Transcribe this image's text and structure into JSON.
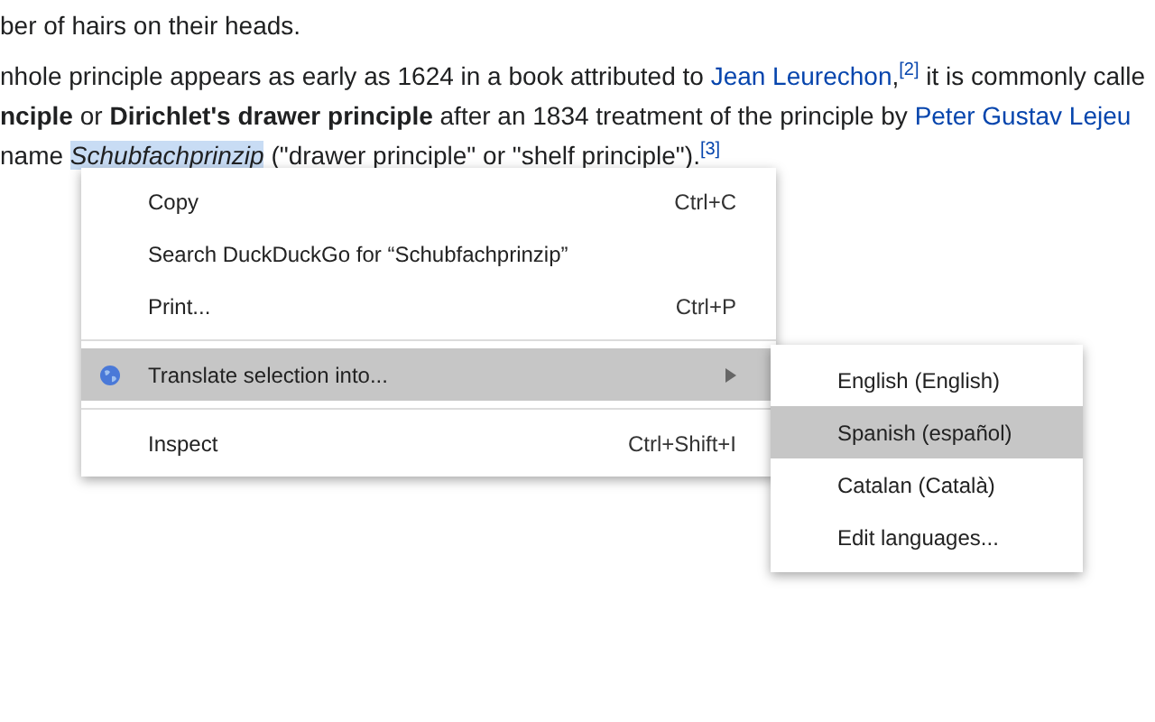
{
  "article": {
    "lines": [
      [
        {
          "kind": "text",
          "text": "ber of hairs on their heads."
        }
      ],
      [
        {
          "kind": "text",
          "text": "nhole principle appears as early as 1624 in a book attributed to "
        },
        {
          "kind": "link",
          "text": "Jean Leurechon"
        },
        {
          "kind": "ref",
          "lead": ",",
          "text": "[2]"
        },
        {
          "kind": "text",
          "text": " it is commonly calle"
        }
      ],
      [
        {
          "kind": "text",
          "text": "**nciple** or **Dirichlet's drawer principle** after an 1834 treatment of the principle by "
        },
        {
          "kind": "link",
          "text": "Peter Gustav Lejeu"
        }
      ],
      [
        {
          "kind": "text",
          "text": "name "
        },
        {
          "kind": "text",
          "text": "Schubfachprinzip",
          "italic": true,
          "selected": true
        },
        {
          "kind": "text",
          "text": " (\"drawer principle\" or \"shelf principle\")."
        },
        {
          "kind": "ref",
          "text": "[3]"
        }
      ]
    ]
  },
  "context_menu": {
    "items": [
      {
        "kind": "item",
        "label": "Copy",
        "shortcut": "Ctrl+C",
        "selected": false
      },
      {
        "kind": "item",
        "label": "Search DuckDuckGo for “Schubfachprinzip”",
        "selected": false
      },
      {
        "kind": "item",
        "label": "Print...",
        "shortcut": "Ctrl+P",
        "selected": false
      },
      {
        "kind": "separator"
      },
      {
        "kind": "submenu",
        "label": "Translate selection into...",
        "selected": true
      },
      {
        "kind": "separator"
      },
      {
        "kind": "item",
        "label": "Inspect",
        "shortcut": "Ctrl+Shift+I",
        "selected": false
      }
    ]
  },
  "submenu": {
    "items": [
      {
        "label": "English (English)",
        "selected": false
      },
      {
        "label": "Spanish (español)",
        "selected": true
      },
      {
        "label": "Catalan (Català)",
        "selected": false
      },
      {
        "label": "Edit languages...",
        "selected": false
      }
    ]
  }
}
